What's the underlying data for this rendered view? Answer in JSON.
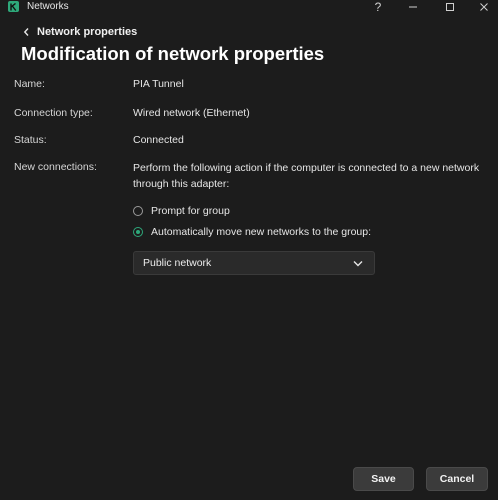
{
  "window": {
    "title": "Networks",
    "help_label": "?",
    "accent_color": "#2ea87a"
  },
  "header": {
    "back_label": "Network properties",
    "title": "Modification of network properties"
  },
  "properties": {
    "name": {
      "label": "Name:",
      "value": "PIA Tunnel"
    },
    "connection_type": {
      "label": "Connection type:",
      "value": "Wired network (Ethernet)"
    },
    "status": {
      "label": "Status:",
      "value": "Connected"
    },
    "new_connections": {
      "label": "New connections:",
      "description": "Perform the following action if the computer is connected to a new network through this adapter:"
    }
  },
  "options": {
    "prompt": {
      "label": "Prompt for group",
      "checked": false
    },
    "auto_move": {
      "label": "Automatically move new networks to the group:",
      "checked": true
    }
  },
  "group_select": {
    "value": "Public network"
  },
  "footer": {
    "save_label": "Save",
    "cancel_label": "Cancel"
  }
}
